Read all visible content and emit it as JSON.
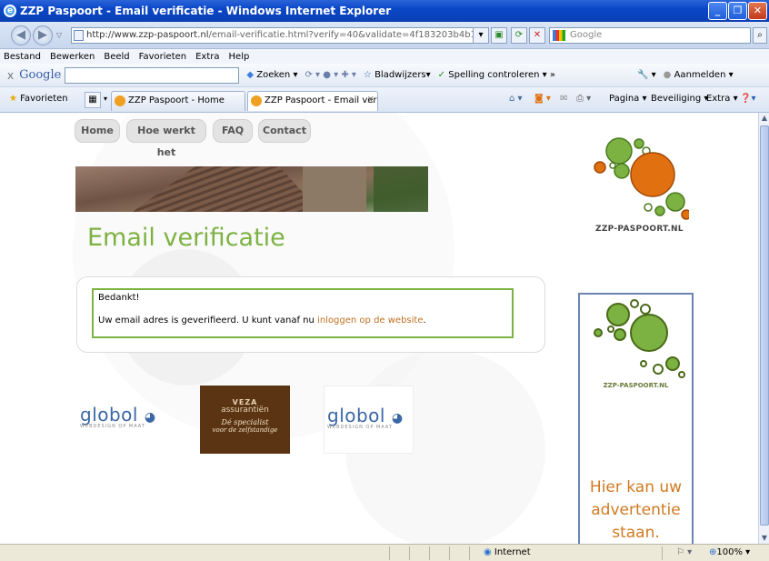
{
  "window": {
    "title": "ZZP Paspoort - Email verificatie - Windows Internet Explorer",
    "minimize": "_",
    "maximize": "❐",
    "close": "✕"
  },
  "address_bar": {
    "url_domain": "http://www.zzp-paspoort.nl",
    "url_path": "/email-verificatie.html?verify=40&validate=4f183203b4b13ebc49502d2cfb16a",
    "search_placeholder": "Google"
  },
  "menu": [
    "Bestand",
    "Bewerken",
    "Beeld",
    "Favorieten",
    "Extra",
    "Help"
  ],
  "google_toolbar": {
    "close": "x",
    "logo": "Google",
    "zoeken": "Zoeken",
    "bladwijzers": "Bladwijzers",
    "spelling": "Spelling controleren",
    "more": "»",
    "aanmelden": "Aanmelden"
  },
  "favorites_bar": {
    "favorites_label": "Favorieten",
    "tabs": [
      "ZZP Paspoort - Home",
      "ZZP Paspoort - Email verif..."
    ],
    "tab_close": "X",
    "commands": [
      "Pagina",
      "Beveiliging",
      "Extra"
    ]
  },
  "page": {
    "nav": [
      "Home",
      "Hoe werkt het",
      "FAQ",
      "Contact"
    ],
    "title": "Email verificatie",
    "message_thanks": "Bedankt!",
    "message_text": "Uw email adres is geverifieerd. U kunt vanaf nu ",
    "message_link": "inloggen op de website",
    "message_end": ".",
    "logo_text": "ZZP-PASPOORT.NL",
    "ad_logo_text": "ZZP-PASPOORT.NL",
    "ad_text": "Hier kan uw advertentie staan.",
    "sponsors": {
      "globol": "globol",
      "globol_sub": "WEBDESIGN OP MAAT",
      "veza_brand": "VEZA",
      "veza_sub": "assurantiën",
      "veza_tag1": "Dé specialist",
      "veza_tag2": "voor de zelfstandige"
    }
  },
  "status_bar": {
    "zone": "Internet",
    "zoom": "100%"
  },
  "colors": {
    "accent_green": "#7cb242",
    "logo_orange": "#e07010",
    "link_orange": "#c07020",
    "ad_border": "#6b85b0"
  }
}
